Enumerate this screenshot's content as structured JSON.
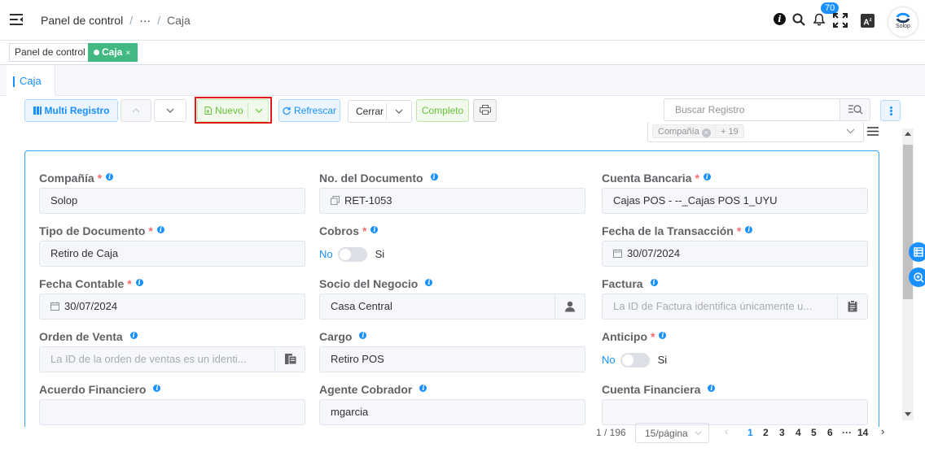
{
  "header": {
    "breadcrumb": [
      "Panel de control",
      "···",
      "Caja"
    ],
    "notifications_count": "70",
    "logo_text": "Solop"
  },
  "tags": [
    {
      "label": "Panel de control"
    },
    {
      "label": "Caja",
      "close": "×"
    }
  ],
  "tab": {
    "label": "Caja"
  },
  "toolbar": {
    "multi_label": "Multi Registro",
    "new_label": "Nuevo",
    "refresh_label": "Refrescar",
    "close_label": "Cerrar",
    "complete_label": "Completo",
    "search_placeholder": "Buscar Registro"
  },
  "columns_select": {
    "chip": "Compañía",
    "more": "+ 19"
  },
  "form": {
    "fields": [
      {
        "label": "Compañía",
        "required": "*",
        "value": "Solop"
      },
      {
        "label": "No. del Documento",
        "required": "",
        "value": "RET-1053"
      },
      {
        "label": "Cuenta Bancaria",
        "required": "*",
        "value": "Cajas POS - --_Cajas POS 1_UYU"
      },
      {
        "label": "Tipo de Documento",
        "required": "*",
        "value": "Retiro de Caja"
      },
      {
        "label": "Cobros",
        "required": "*",
        "switch_off": "No",
        "switch_on": "Si"
      },
      {
        "label": "Fecha de la Transacción",
        "required": "*",
        "value": "30/07/2024"
      },
      {
        "label": "Fecha Contable",
        "required": "*",
        "value": "30/07/2024"
      },
      {
        "label": "Socio del Negocio",
        "required": "",
        "value": "Casa Central"
      },
      {
        "label": "Factura",
        "required": "",
        "placeholder": "La ID de Factura identifica únicamente u..."
      },
      {
        "label": "Orden de Venta",
        "required": "",
        "placeholder": "La ID de la orden de ventas es un identi..."
      },
      {
        "label": "Cargo",
        "required": "",
        "value": "Retiro POS"
      },
      {
        "label": "Anticipo",
        "required": "*",
        "switch_off": "No",
        "switch_on": "Si"
      },
      {
        "label": "Acuerdo Financiero",
        "required": "",
        "value": ""
      },
      {
        "label": "Agente Cobrador",
        "required": "",
        "value": "mgarcia"
      },
      {
        "label": "Cuenta Financiera",
        "required": "",
        "value": ""
      }
    ]
  },
  "pagination": {
    "total": "1 / 196",
    "page_size": "15/página",
    "pages": [
      "1",
      "2",
      "3",
      "4",
      "5",
      "6",
      "···",
      "14"
    ],
    "current": "1"
  },
  "colors": {
    "primary": "#1890ff",
    "success": "#67c23a",
    "tag_active": "#42b983",
    "highlight": "#e01b1b"
  }
}
